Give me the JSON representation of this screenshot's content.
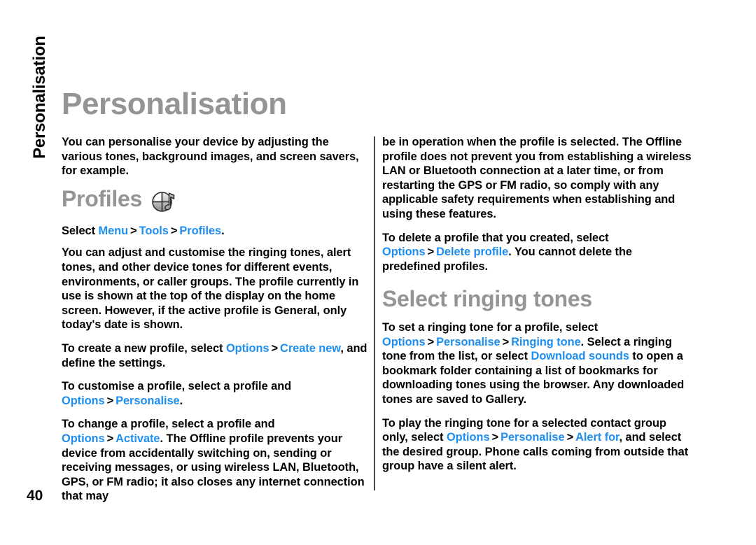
{
  "page": {
    "number": "40",
    "chapter_tab": "Personalisation",
    "title": "Personalisation",
    "accent_color": "#1e8ef0",
    "heading_color": "#949494",
    "body_color": "#000000",
    "background_color": "#ffffff"
  },
  "left_column": {
    "intro_paragraph": "You can personalise your device by adjusting the various tones, background images, and screen savers, for example.",
    "profiles_heading": "Profiles",
    "profiles_icon_name": "profiles-sphere-note-icon",
    "select_path": {
      "lead": "Select ",
      "item1": "Menu",
      "sep1": ">",
      "item2": "Tools",
      "sep2": ">",
      "item3": "Profiles",
      "trail": "."
    },
    "paragraph_adjust": "You can adjust and customise the ringing tones, alert tones, and other device tones for different events, environments, or caller groups. The profile currently in use is shown at the top of the display on the home screen. However, if the active profile is General, only today's date is shown.",
    "paragraph_create": {
      "part1": "To create a new profile, select ",
      "ui1": "Options",
      "sep1": ">",
      "ui2": "Create new",
      "part2": ", and define the settings."
    },
    "paragraph_customise": {
      "part1": "To customise a profile, select a profile and ",
      "ui1": "Options",
      "sep1": ">",
      "ui2": "Personalise",
      "part2": "."
    },
    "paragraph_change": {
      "part1": "To change a profile, select a profile and ",
      "ui1": "Options",
      "sep1": ">",
      "ui2": "Activate",
      "part2": ". The Offline profile prevents your device from accidentally switching on, sending or receiving messages, or using wireless LAN, Bluetooth, GPS, or FM radio; it also closes any internet connection that may"
    }
  },
  "right_column": {
    "paragraph_offline_cont": "be in operation when the profile is selected. The Offline profile does not prevent you from establishing a wireless LAN or Bluetooth connection at a later time, or from restarting the GPS or FM radio, so comply with any applicable safety requirements when establishing and using these features.",
    "paragraph_delete": {
      "part1": "To delete a profile that you created, select ",
      "ui1": "Options",
      "sep1": ">",
      "ui2": "Delete profile",
      "part2": ". You cannot delete the predefined profiles."
    },
    "ringing_heading": "Select ringing tones",
    "paragraph_set_tone": {
      "part1": "To set a ringing tone for a profile, select ",
      "ui1": "Options",
      "sep1": ">",
      "ui2": "Personalise",
      "sep2": ">",
      "ui3": "Ringing tone",
      "part2": ". Select a ringing tone from the list, or select ",
      "ui4": "Download sounds",
      "part3": " to open a bookmark folder containing a list of bookmarks for downloading tones using the browser. Any downloaded tones are saved to Gallery."
    },
    "paragraph_contact_group": {
      "part1": "To play the ringing tone for a selected contact group only, select ",
      "ui1": "Options",
      "sep1": ">",
      "ui2": "Personalise",
      "sep2": ">",
      "ui3": "Alert for",
      "part2": ", and select the desired group. Phone calls coming from outside that group have a silent alert."
    }
  }
}
